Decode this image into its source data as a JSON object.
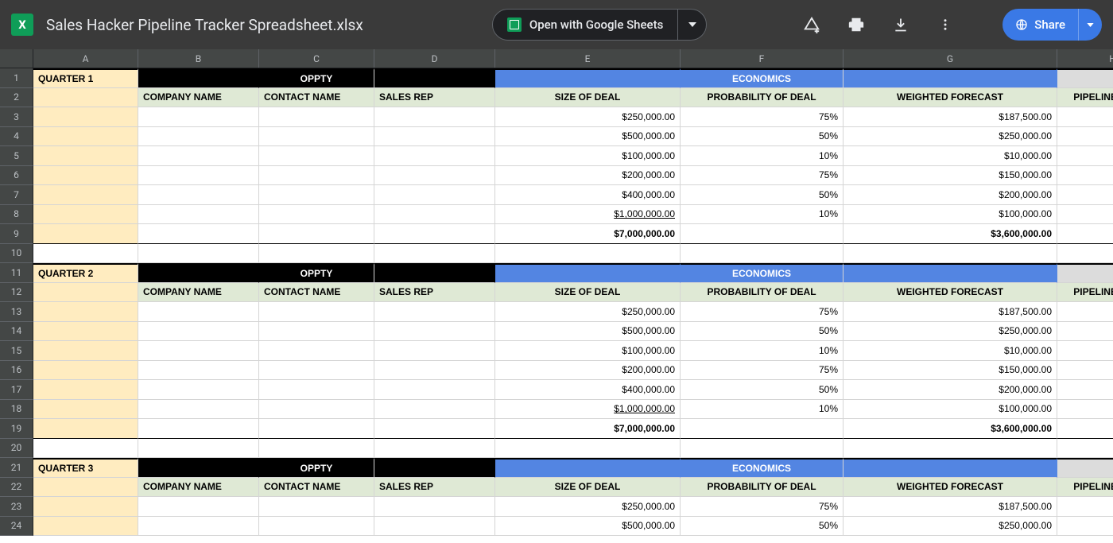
{
  "header": {
    "app_icon_letter": "X",
    "filename": "Sales Hacker Pipeline Tracker Spreadsheet.xlsx",
    "open_label": "Open with Google Sheets",
    "share_label": "Share"
  },
  "columns": [
    "A",
    "B",
    "C",
    "D",
    "E",
    "F",
    "G",
    "H"
  ],
  "labels": {
    "oppty": "OPPTY",
    "economics": "ECONOMICS",
    "company": "COMPANY NAME",
    "contact": "CONTACT NAME",
    "rep": "SALES REP",
    "size": "SIZE OF DEAL",
    "prob": "PROBABILITY OF DEAL",
    "forecast": "WEIGHTED FORECAST",
    "stage": "PIPELINE STAGE"
  },
  "quarters": [
    {
      "title": "QUARTER 1",
      "rows": [
        {
          "size": "$250,000.00",
          "prob": "75%",
          "forecast": "$187,500.00"
        },
        {
          "size": "$500,000.00",
          "prob": "50%",
          "forecast": "$250,000.00"
        },
        {
          "size": "$100,000.00",
          "prob": "10%",
          "forecast": "$10,000.00"
        },
        {
          "size": "$200,000.00",
          "prob": "75%",
          "forecast": "$150,000.00"
        },
        {
          "size": "$400,000.00",
          "prob": "50%",
          "forecast": "$200,000.00"
        },
        {
          "size": "$1,000,000.00",
          "prob": "10%",
          "forecast": "$100,000.00",
          "under": true
        }
      ],
      "total": {
        "size": "$7,000,000.00",
        "forecast": "$3,600,000.00"
      }
    },
    {
      "title": "QUARTER 2",
      "rows": [
        {
          "size": "$250,000.00",
          "prob": "75%",
          "forecast": "$187,500.00"
        },
        {
          "size": "$500,000.00",
          "prob": "50%",
          "forecast": "$250,000.00"
        },
        {
          "size": "$100,000.00",
          "prob": "10%",
          "forecast": "$10,000.00"
        },
        {
          "size": "$200,000.00",
          "prob": "75%",
          "forecast": "$150,000.00"
        },
        {
          "size": "$400,000.00",
          "prob": "50%",
          "forecast": "$200,000.00"
        },
        {
          "size": "$1,000,000.00",
          "prob": "10%",
          "forecast": "$100,000.00",
          "under": true
        }
      ],
      "total": {
        "size": "$7,000,000.00",
        "forecast": "$3,600,000.00"
      }
    },
    {
      "title": "QUARTER 3",
      "rows": [
        {
          "size": "$250,000.00",
          "prob": "75%",
          "forecast": "$187,500.00"
        },
        {
          "size": "$500,000.00",
          "prob": "50%",
          "forecast": "$250,000.00"
        }
      ]
    }
  ]
}
